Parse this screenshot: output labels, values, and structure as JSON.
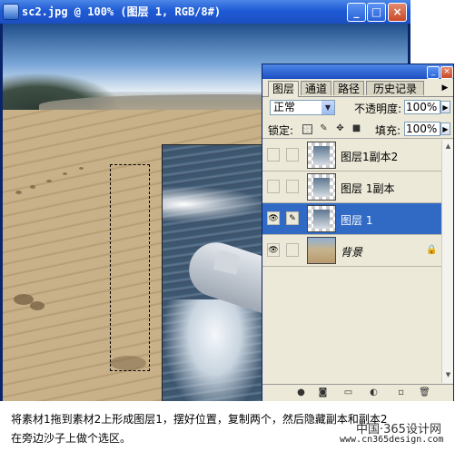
{
  "document_window": {
    "title": "sc2.jpg @ 100% (图层 1, RGB/8#)",
    "minimize_glyph": "_",
    "maximize_glyph": "□",
    "close_glyph": "×"
  },
  "layers_palette": {
    "tabs": [
      {
        "label": "图层",
        "active": true
      },
      {
        "label": "通道",
        "active": false
      },
      {
        "label": "路径",
        "active": false
      },
      {
        "label": "历史记录",
        "active": false
      }
    ],
    "blend_mode": "正常",
    "opacity_label": "不透明度:",
    "opacity_value": "100%",
    "lock_label": "锁定:",
    "fill_label": "填充:",
    "fill_value": "100%",
    "layers": [
      {
        "name": "图层1副本2",
        "visible": false,
        "selected": false
      },
      {
        "name": "图层 1副本",
        "visible": false,
        "selected": false
      },
      {
        "name": "图层 1",
        "visible": true,
        "selected": true
      },
      {
        "name": "背景",
        "visible": true,
        "selected": false,
        "locked": true
      }
    ],
    "icons": {
      "eye": "visibility-eye-icon",
      "brush": "paintbrush-icon",
      "lock": "lock-icon"
    }
  },
  "caption": {
    "line1": "将素材1拖到素材2上形成图层1，摆好位置，复制两个，然后隐藏副本和副本2",
    "line2": "在旁边沙子上做个选区。"
  },
  "watermark": {
    "site_name": "中国·365设计网",
    "url": "www.cn365design.com"
  }
}
